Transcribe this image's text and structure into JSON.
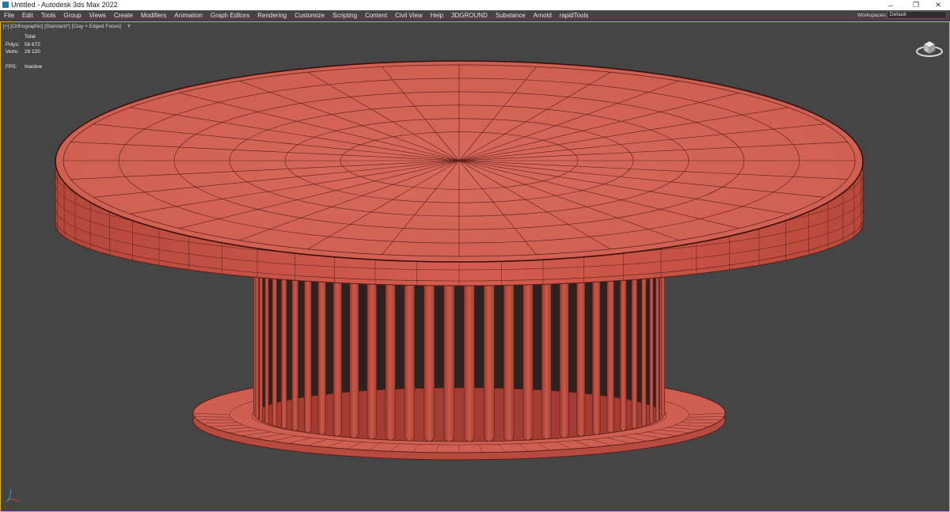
{
  "window": {
    "title": "Untitled - Autodesk 3ds Max 2022",
    "controls": [
      "─",
      "❐",
      "✕"
    ]
  },
  "menu": {
    "items": [
      "File",
      "Edit",
      "Tools",
      "Group",
      "Views",
      "Create",
      "Modifiers",
      "Animation",
      "Graph Editors",
      "Rendering",
      "Customize",
      "Scripting",
      "Content",
      "Civil View",
      "Help",
      "3DGROUND",
      "Substance",
      "Arnold",
      "rapidTools"
    ],
    "workspaces_label": "Workspaces:",
    "workspaces_value": "Default"
  },
  "viewport": {
    "label": "[+] [Orthographic] [Standard*] [Clay + Edged Faces]",
    "filter_icon": "funnel-icon",
    "stats": {
      "header": "Total",
      "polys_label": "Polys:",
      "polys_value": "56 672",
      "verts_label": "Verts:",
      "verts_value": "28 220",
      "fps_label": "FPS:",
      "fps_value": "Inactive"
    },
    "colors": {
      "background": "#454545",
      "active_border": "#e8b600",
      "clay": "#cf5a4c",
      "clay_dark": "#b4463b",
      "wire": "#5a1e18"
    }
  }
}
